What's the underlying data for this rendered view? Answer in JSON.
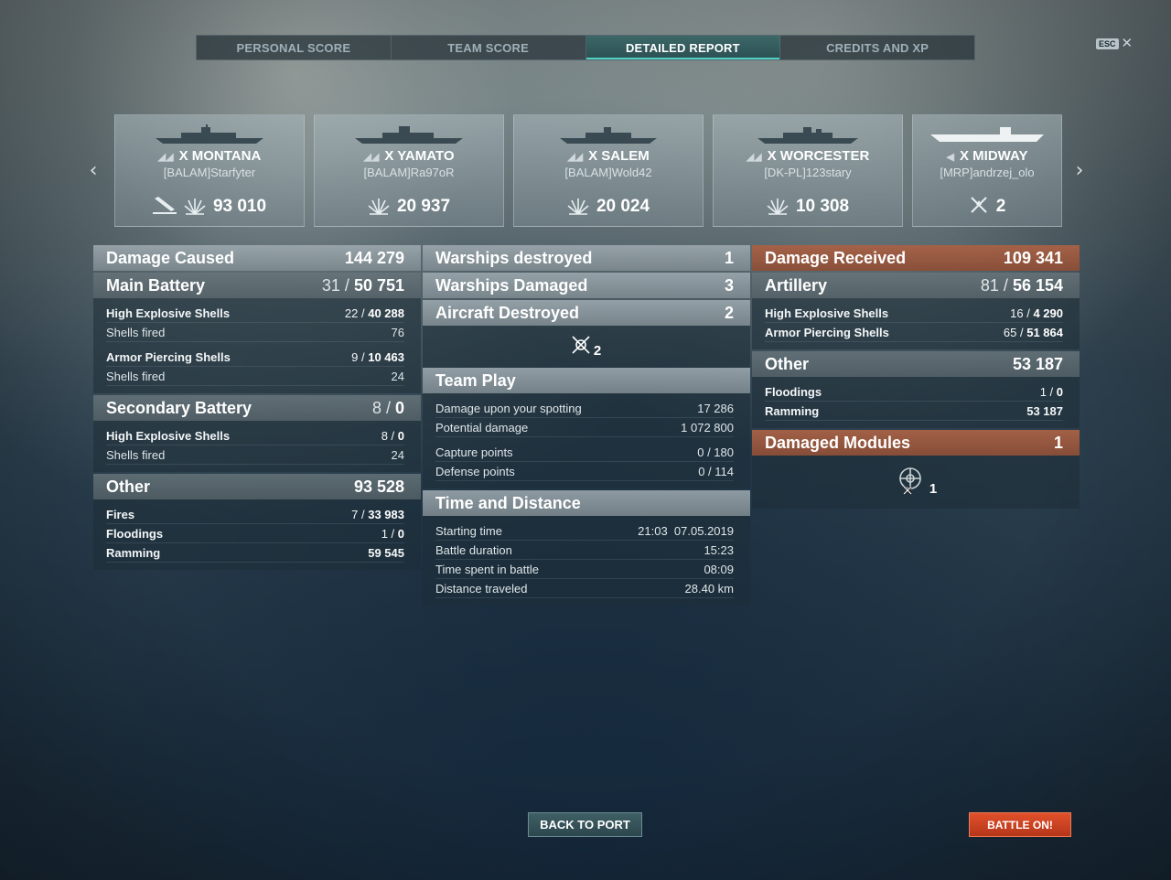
{
  "tabs": [
    {
      "label": "PERSONAL SCORE",
      "active": false
    },
    {
      "label": "TEAM SCORE",
      "active": false
    },
    {
      "label": "DETAILED REPORT",
      "active": true
    },
    {
      "label": "CREDITS AND XP",
      "active": false
    }
  ],
  "esc": {
    "key": "ESC",
    "close": "✕"
  },
  "carousel": {
    "prev": "‹",
    "next": "›",
    "cards": [
      {
        "class": "◢◢",
        "name": "X MONTANA",
        "player": "[BALAM]Starfyter",
        "icons": [
          "sunk-ship-icon",
          "damage-icon"
        ],
        "value": "93 010"
      },
      {
        "class": "◢◢",
        "name": "X YAMATO",
        "player": "[BALAM]Ra97oR",
        "icons": [
          "damage-icon"
        ],
        "value": "20 937"
      },
      {
        "class": "◢◢",
        "name": "X SALEM",
        "player": "[BALAM]Wold42",
        "icons": [
          "damage-icon"
        ],
        "value": "20 024"
      },
      {
        "class": "◢◢",
        "name": "X WORCESTER",
        "player": "[DK-PL]123stary",
        "icons": [
          "damage-icon"
        ],
        "value": "10 308"
      },
      {
        "class": "◀",
        "name": "X MIDWAY",
        "player": "[MRP]andrzej_olo",
        "icons": [
          "plane-shot-icon"
        ],
        "value": "2"
      }
    ]
  },
  "damage_caused": {
    "title": "Damage Caused",
    "total": "144 279",
    "main_battery": {
      "title": "Main Battery",
      "hits": "31",
      "value": "50 751",
      "he": {
        "label": "High Explosive Shells",
        "hits": "22",
        "value": "40 288",
        "fired_label": "Shells fired",
        "fired": "76"
      },
      "ap": {
        "label": "Armor Piercing Shells",
        "hits": "9",
        "value": "10 463",
        "fired_label": "Shells fired",
        "fired": "24"
      }
    },
    "secondary": {
      "title": "Secondary Battery",
      "hits": "8",
      "value": "0",
      "he": {
        "label": "High Explosive Shells",
        "hits": "8",
        "value": "0",
        "fired_label": "Shells fired",
        "fired": "24"
      }
    },
    "other": {
      "title": "Other",
      "total": "93 528",
      "fires": {
        "label": "Fires",
        "count": "7",
        "value": "33 983"
      },
      "floodings": {
        "label": "Floodings",
        "count": "1",
        "value": "0"
      },
      "ramming": {
        "label": "Ramming",
        "value": "59 545"
      }
    }
  },
  "middle": {
    "warships_destroyed": {
      "label": "Warships destroyed",
      "value": "1"
    },
    "warships_damaged": {
      "label": "Warships Damaged",
      "value": "3"
    },
    "aircraft_destroyed": {
      "label": "Aircraft Destroyed",
      "value": "2",
      "icon_count": "2"
    },
    "team_play": {
      "title": "Team Play",
      "spotting": {
        "label": "Damage upon your spotting",
        "value": "17 286"
      },
      "potential": {
        "label": "Potential damage",
        "value": "1 072 800"
      },
      "capture": {
        "label": "Capture points",
        "value": "0 / 180"
      },
      "defense": {
        "label": "Defense points",
        "value": "0 / 114"
      }
    },
    "time": {
      "title": "Time and Distance",
      "start": {
        "label": "Starting time",
        "value": "21:03  07.05.2019"
      },
      "duration": {
        "label": "Battle duration",
        "value": "15:23"
      },
      "spent": {
        "label": "Time spent in battle",
        "value": "08:09"
      },
      "distance": {
        "label": "Distance traveled",
        "value": "28.40 km"
      }
    }
  },
  "damage_received": {
    "title": "Damage Received",
    "total": "109 341",
    "artillery": {
      "title": "Artillery",
      "hits": "81",
      "value": "56 154",
      "he": {
        "label": "High Explosive Shells",
        "hits": "16",
        "value": "4 290"
      },
      "ap": {
        "label": "Armor Piercing Shells",
        "hits": "65",
        "value": "51 864"
      }
    },
    "other": {
      "title": "Other",
      "total": "53 187",
      "floodings": {
        "label": "Floodings",
        "count": "1",
        "value": "0"
      },
      "ramming": {
        "label": "Ramming",
        "value": "53 187"
      }
    },
    "modules": {
      "title": "Damaged Modules",
      "value": "1",
      "icon_count": "1"
    }
  },
  "buttons": {
    "back": "BACK TO PORT",
    "battle": "BATTLE ON!"
  },
  "colors": {
    "accent": "#4fd3c4",
    "battle": "#d9441f",
    "received": "#a8624a"
  }
}
